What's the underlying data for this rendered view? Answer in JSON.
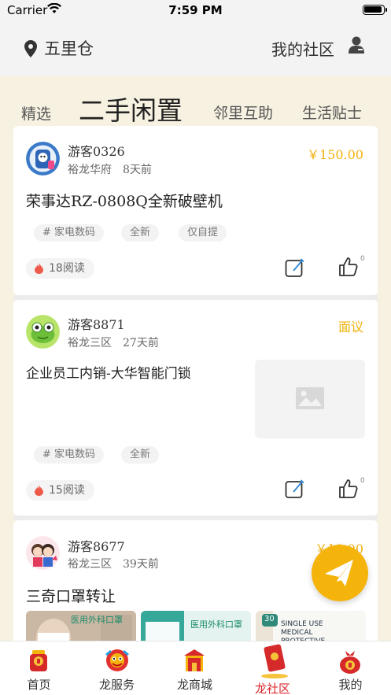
{
  "status_bar": {
    "carrier": "Carrier",
    "time": "7:59 PM"
  },
  "header": {
    "location": "五里仓",
    "community": "我的社区"
  },
  "tabs": [
    {
      "label": "精选"
    },
    {
      "label": "二手闲置",
      "active": true
    },
    {
      "label": "邻里互助"
    },
    {
      "label": "生活贴士"
    }
  ],
  "posts": [
    {
      "user": "游客0326",
      "location": "裕龙华府",
      "time": "8天前",
      "price": "￥150.00",
      "title": "荣事达RZ-0808Q全新破壁机",
      "tags": [
        "# 家电数码",
        "全新",
        "仅自提"
      ],
      "views": "18阅读",
      "likes": "0"
    },
    {
      "user": "游客8871",
      "location": "裕龙三区",
      "time": "27天前",
      "price": "面议",
      "title": "企业员工内销-大华智能门锁",
      "tags": [
        "# 家电数码",
        "全新"
      ],
      "views": "15阅读",
      "likes": "0"
    },
    {
      "user": "游客8677",
      "location": "裕龙三区",
      "time": "39天前",
      "price": "￥10.00",
      "title": "三奇口罩转让",
      "images": [
        {
          "caption": "医用外科口罩"
        },
        {
          "caption": "医用外科口罩"
        },
        {
          "caption": "SINGLE USE MEDICAL PROTECTIVE",
          "badge": "30"
        }
      ]
    }
  ],
  "nav": [
    {
      "label": "首页"
    },
    {
      "label": "龙服务"
    },
    {
      "label": "龙商城"
    },
    {
      "label": "龙社区",
      "active": true
    },
    {
      "label": "我的"
    }
  ],
  "colors": {
    "accent": "#f5b40c",
    "price": "#f2b20c",
    "nav_active": "#d9252a",
    "page_bg": "#f7f1e1"
  },
  "icons": [
    "wifi-icon",
    "location-pin-icon",
    "user-icon",
    "flame-icon",
    "edit-icon",
    "thumbs-up-icon",
    "image-placeholder-icon",
    "paper-plane-icon"
  ]
}
